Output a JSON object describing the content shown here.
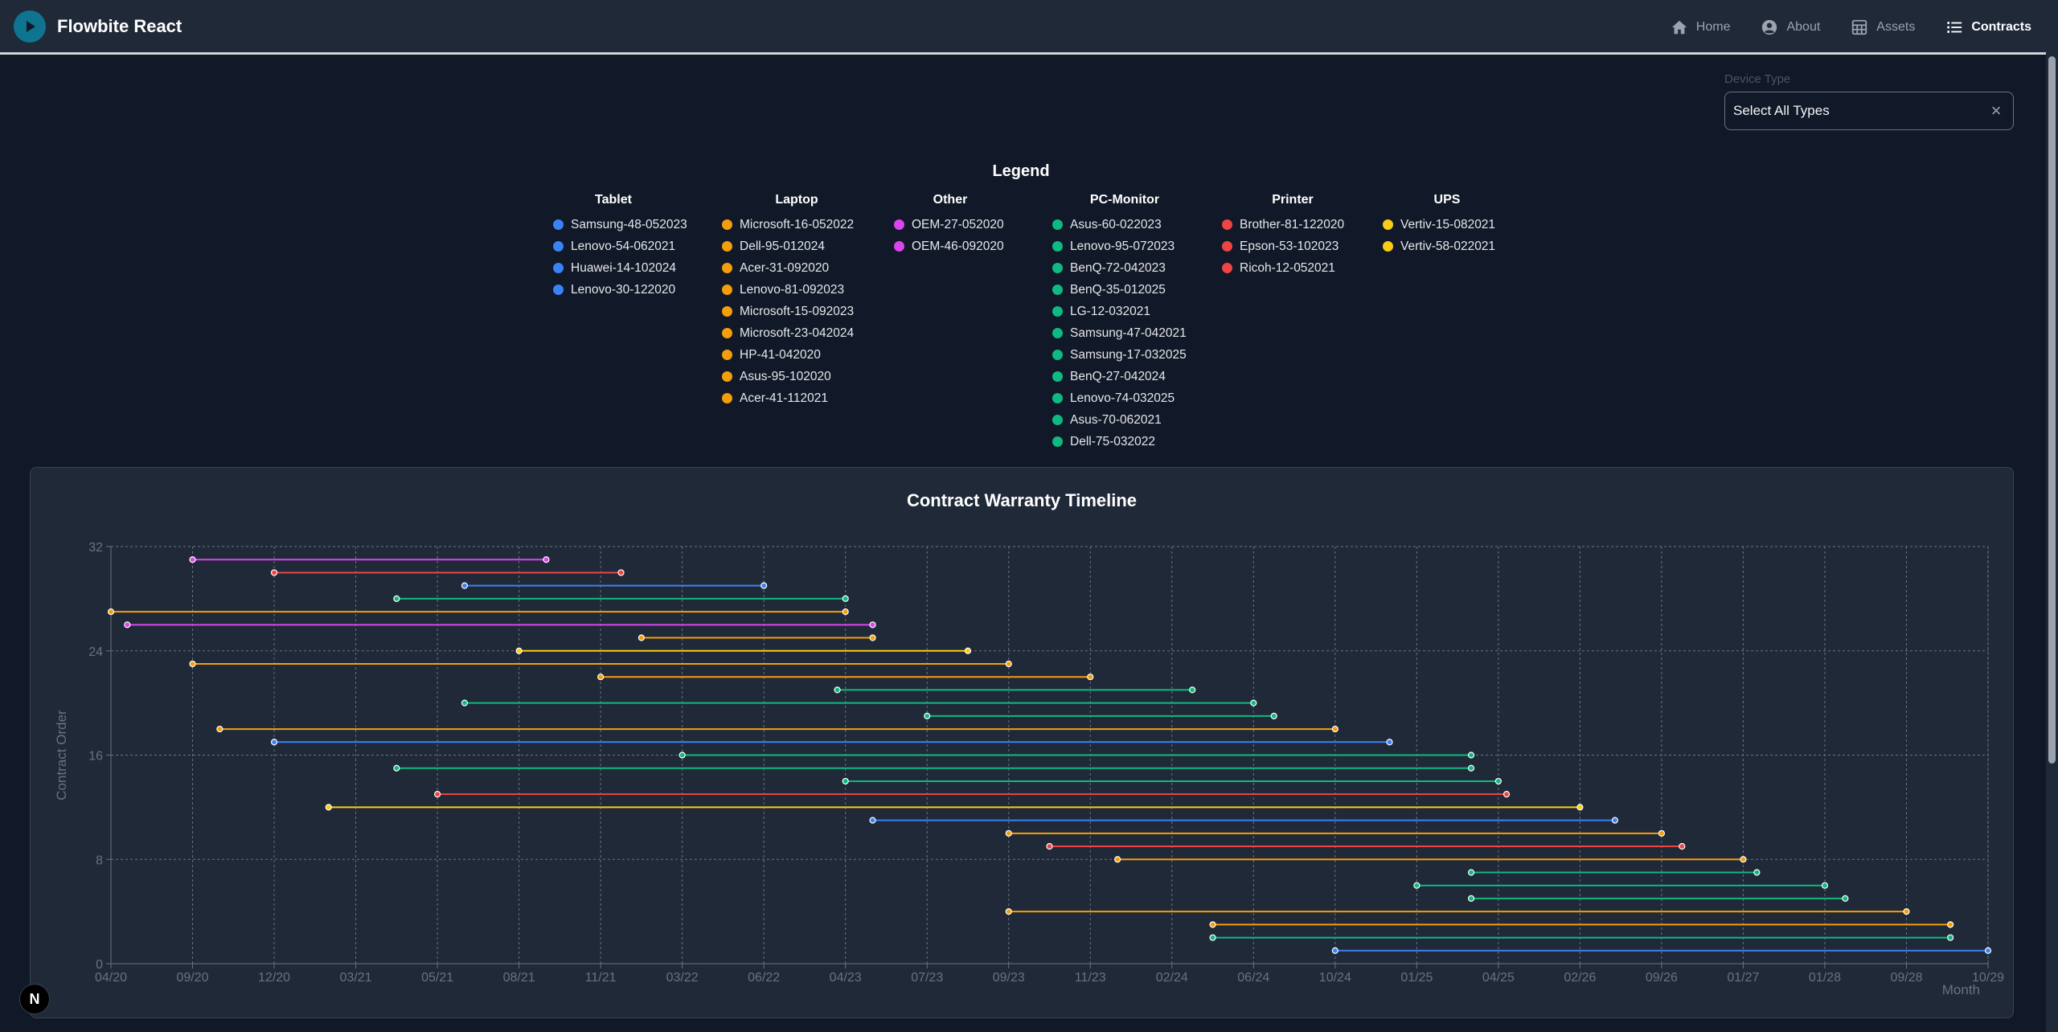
{
  "app": {
    "title": "Flowbite React"
  },
  "nav": {
    "items": [
      {
        "label": "Home",
        "icon": "home-icon",
        "active": false
      },
      {
        "label": "About",
        "icon": "user-circle-icon",
        "active": false
      },
      {
        "label": "Assets",
        "icon": "table-icon",
        "active": false
      },
      {
        "label": "Contracts",
        "icon": "list-icon",
        "active": true
      }
    ]
  },
  "filter": {
    "label": "Device Type",
    "value": "Select All Types",
    "clear_icon": "close-icon"
  },
  "legend": {
    "title": "Legend",
    "groups": [
      {
        "name": "Tablet",
        "color": "#3b82f6",
        "items": [
          "Samsung-48-052023",
          "Lenovo-54-062021",
          "Huawei-14-102024",
          "Lenovo-30-122020"
        ]
      },
      {
        "name": "Laptop",
        "color": "#f59e0b",
        "items": [
          "Microsoft-16-052022",
          "Dell-95-012024",
          "Acer-31-092020",
          "Lenovo-81-092023",
          "Microsoft-15-092023",
          "Microsoft-23-042024",
          "HP-41-042020",
          "Asus-95-102020",
          "Acer-41-112021"
        ]
      },
      {
        "name": "Other",
        "color": "#d946ef",
        "items": [
          "OEM-27-052020",
          "OEM-46-092020"
        ]
      },
      {
        "name": "PC-Monitor",
        "color": "#10b981",
        "items": [
          "Asus-60-022023",
          "Lenovo-95-072023",
          "BenQ-72-042023",
          "BenQ-35-012025",
          "LG-12-032021",
          "Samsung-47-042021",
          "Samsung-17-032025",
          "BenQ-27-042024",
          "Lenovo-74-032025",
          "Asus-70-062021",
          "Dell-75-032022"
        ]
      },
      {
        "name": "Printer",
        "color": "#ef4444",
        "items": [
          "Brother-81-122020",
          "Epson-53-102023",
          "Ricoh-12-052021"
        ]
      },
      {
        "name": "UPS",
        "color": "#facc15",
        "items": [
          "Vertiv-15-082021",
          "Vertiv-58-022021"
        ]
      }
    ]
  },
  "chart_data": {
    "type": "line",
    "title": "Contract Warranty Timeline",
    "xlabel": "Month",
    "ylabel": "Contract Order",
    "x_ticks": [
      "04/20",
      "09/20",
      "12/20",
      "03/21",
      "05/21",
      "08/21",
      "11/21",
      "03/22",
      "06/22",
      "04/23",
      "07/23",
      "09/23",
      "11/23",
      "02/24",
      "06/24",
      "10/24",
      "01/25",
      "04/25",
      "02/26",
      "09/26",
      "01/27",
      "01/28",
      "09/28",
      "10/29"
    ],
    "y_ticks": [
      0,
      8,
      16,
      24,
      32
    ],
    "ylim": [
      0,
      32
    ],
    "grid": true,
    "series": [
      {
        "order": 31,
        "category": "Other",
        "start": "09/20",
        "end": "09/21"
      },
      {
        "order": 30,
        "category": "Printer",
        "start": "12/20",
        "end": "12/21"
      },
      {
        "order": 29,
        "category": "Tablet",
        "start": "06/21",
        "end": "06/22"
      },
      {
        "order": 28,
        "category": "PC-Monitor",
        "start": "04/21",
        "end": "04/23"
      },
      {
        "order": 27,
        "category": "Laptop",
        "start": "04/20",
        "end": "04/23"
      },
      {
        "order": 26,
        "category": "Other",
        "start": "05/20",
        "end": "05/23"
      },
      {
        "order": 25,
        "category": "Laptop",
        "start": "01/22",
        "end": "05/23"
      },
      {
        "order": 24,
        "category": "UPS",
        "start": "08/21",
        "end": "08/23"
      },
      {
        "order": 23,
        "category": "Laptop",
        "start": "09/20",
        "end": "09/23"
      },
      {
        "order": 22,
        "category": "Laptop",
        "start": "11/21",
        "end": "11/23"
      },
      {
        "order": 21,
        "category": "PC-Monitor",
        "start": "03/23",
        "end": "03/24"
      },
      {
        "order": 20,
        "category": "PC-Monitor",
        "start": "06/21",
        "end": "06/24"
      },
      {
        "order": 19,
        "category": "PC-Monitor",
        "start": "07/23",
        "end": "07/24"
      },
      {
        "order": 18,
        "category": "Laptop",
        "start": "10/20",
        "end": "10/24"
      },
      {
        "order": 17,
        "category": "Tablet",
        "start": "12/20",
        "end": "12/24"
      },
      {
        "order": 16,
        "category": "PC-Monitor",
        "start": "03/22",
        "end": "03/25"
      },
      {
        "order": 15,
        "category": "PC-Monitor",
        "start": "04/21",
        "end": "03/25"
      },
      {
        "order": 14,
        "category": "PC-Monitor",
        "start": "04/23",
        "end": "04/25"
      },
      {
        "order": 13,
        "category": "Printer",
        "start": "05/21",
        "end": "05/25"
      },
      {
        "order": 12,
        "category": "UPS",
        "start": "02/21",
        "end": "02/26"
      },
      {
        "order": 11,
        "category": "Tablet",
        "start": "05/23",
        "end": "05/26"
      },
      {
        "order": 10,
        "category": "Laptop",
        "start": "09/23",
        "end": "09/26"
      },
      {
        "order": 9,
        "category": "Printer",
        "start": "10/23",
        "end": "10/26"
      },
      {
        "order": 8,
        "category": "Laptop",
        "start": "12/23",
        "end": "01/27"
      },
      {
        "order": 7,
        "category": "PC-Monitor",
        "start": "03/25",
        "end": "03/27"
      },
      {
        "order": 6,
        "category": "PC-Monitor",
        "start": "01/25",
        "end": "01/28"
      },
      {
        "order": 5,
        "category": "PC-Monitor",
        "start": "03/25",
        "end": "03/28"
      },
      {
        "order": 4,
        "category": "Laptop",
        "start": "09/23",
        "end": "09/28"
      },
      {
        "order": 3,
        "category": "Laptop",
        "start": "04/24",
        "end": "04/29"
      },
      {
        "order": 2,
        "category": "PC-Monitor",
        "start": "04/24",
        "end": "04/29"
      },
      {
        "order": 1,
        "category": "Tablet",
        "start": "10/24",
        "end": "10/29"
      }
    ]
  },
  "badge": {
    "label": "N"
  }
}
